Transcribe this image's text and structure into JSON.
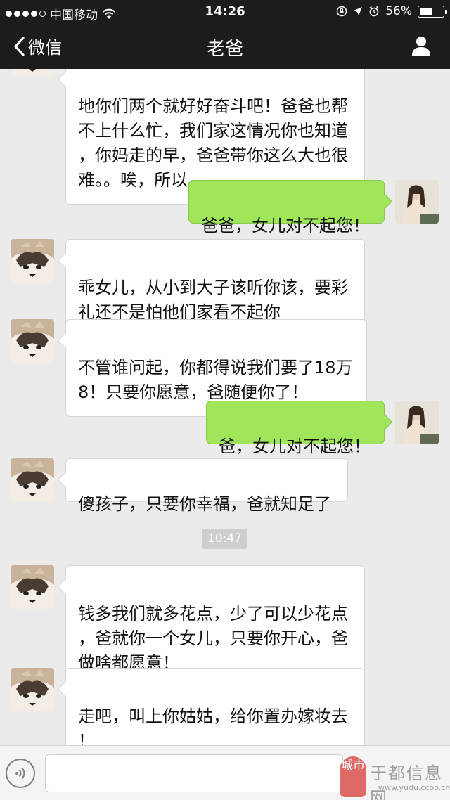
{
  "status_bar": {
    "carrier": "中国移动",
    "time": "14:26",
    "battery": "56%",
    "battery_level": 0.56,
    "signal_bars_filled": 4,
    "icons": [
      "wifi-icon",
      "lock-rotation-icon",
      "location-icon",
      "alarm-icon",
      "battery-icon"
    ]
  },
  "nav": {
    "back_label": "微信",
    "title": "老爸",
    "right_icon": "person-icon"
  },
  "messages": [
    {
      "side": "in",
      "avatar": "dad-avatar",
      "text": "地你们两个就好好奋斗吧！爸爸也帮\n不上什么忙，我们家这情况你也知道\n，你妈走的早，爸爸带你这么大也很\n难。。唉，所以。。。"
    },
    {
      "side": "out",
      "avatar": "me-avatar",
      "text": "爸爸，女儿对不起您！"
    },
    {
      "side": "in",
      "avatar": "dad-avatar",
      "text": "乖女儿，从小到大子该听你该，要彩\n礼还不是怕他们家看不起你"
    },
    {
      "side": "in",
      "avatar": "dad-avatar",
      "text": "不管谁问起，你都得说我们要了18万\n8！只要你愿意，爸随便你了！"
    },
    {
      "side": "out",
      "avatar": "me-avatar",
      "text": "爸，女儿对不起您！"
    },
    {
      "side": "in",
      "avatar": "dad-avatar",
      "text": "傻孩子，只要你幸福，爸就知足了"
    },
    {
      "side": "in",
      "avatar": "dad-avatar",
      "text": "钱多我们就多花点，少了可以少花点\n，爸就你一个女儿，只要你开心，爸\n做啥都愿意！"
    },
    {
      "side": "in",
      "avatar": "dad-avatar",
      "text": "走吧，叫上你姑姑，给你置办嫁妆去\n！"
    }
  ],
  "timestamp": "10:47",
  "input_bar": {
    "voice_icon": "voice-icon",
    "text_value": ""
  },
  "watermark": {
    "badge": "城市",
    "text": "于都信息网",
    "url": "www.yudu.ccoo.cn"
  },
  "colors": {
    "nav_bg": "#1c1c1f",
    "chat_bg": "#ebebeb",
    "bubble_in": "#ffffff",
    "bubble_out": "#9fe65a"
  }
}
